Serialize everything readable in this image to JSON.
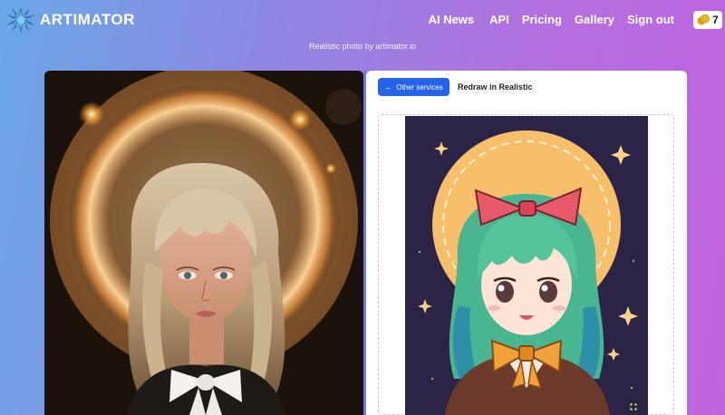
{
  "brand": {
    "name": "ARTIMATOR"
  },
  "nav": {
    "items": [
      {
        "label": "AI News"
      },
      {
        "label": "API"
      },
      {
        "label": "Pricing"
      },
      {
        "label": "Gallery"
      },
      {
        "label": "Sign out"
      }
    ],
    "credits": "7"
  },
  "subtitle": "Realistic photo by artimator.io",
  "card": {
    "back_label": "Other services",
    "title": "Redraw in Realistic"
  },
  "icons": {
    "logo": "starburst-logo-icon",
    "coin": "coin-icon",
    "back": "arrow-left-icon",
    "fullscreen": "expand-icon"
  },
  "colors": {
    "accent": "#2563eb",
    "bg_gradient_start": "#6aa7e6",
    "bg_gradient_end": "#c063df"
  }
}
